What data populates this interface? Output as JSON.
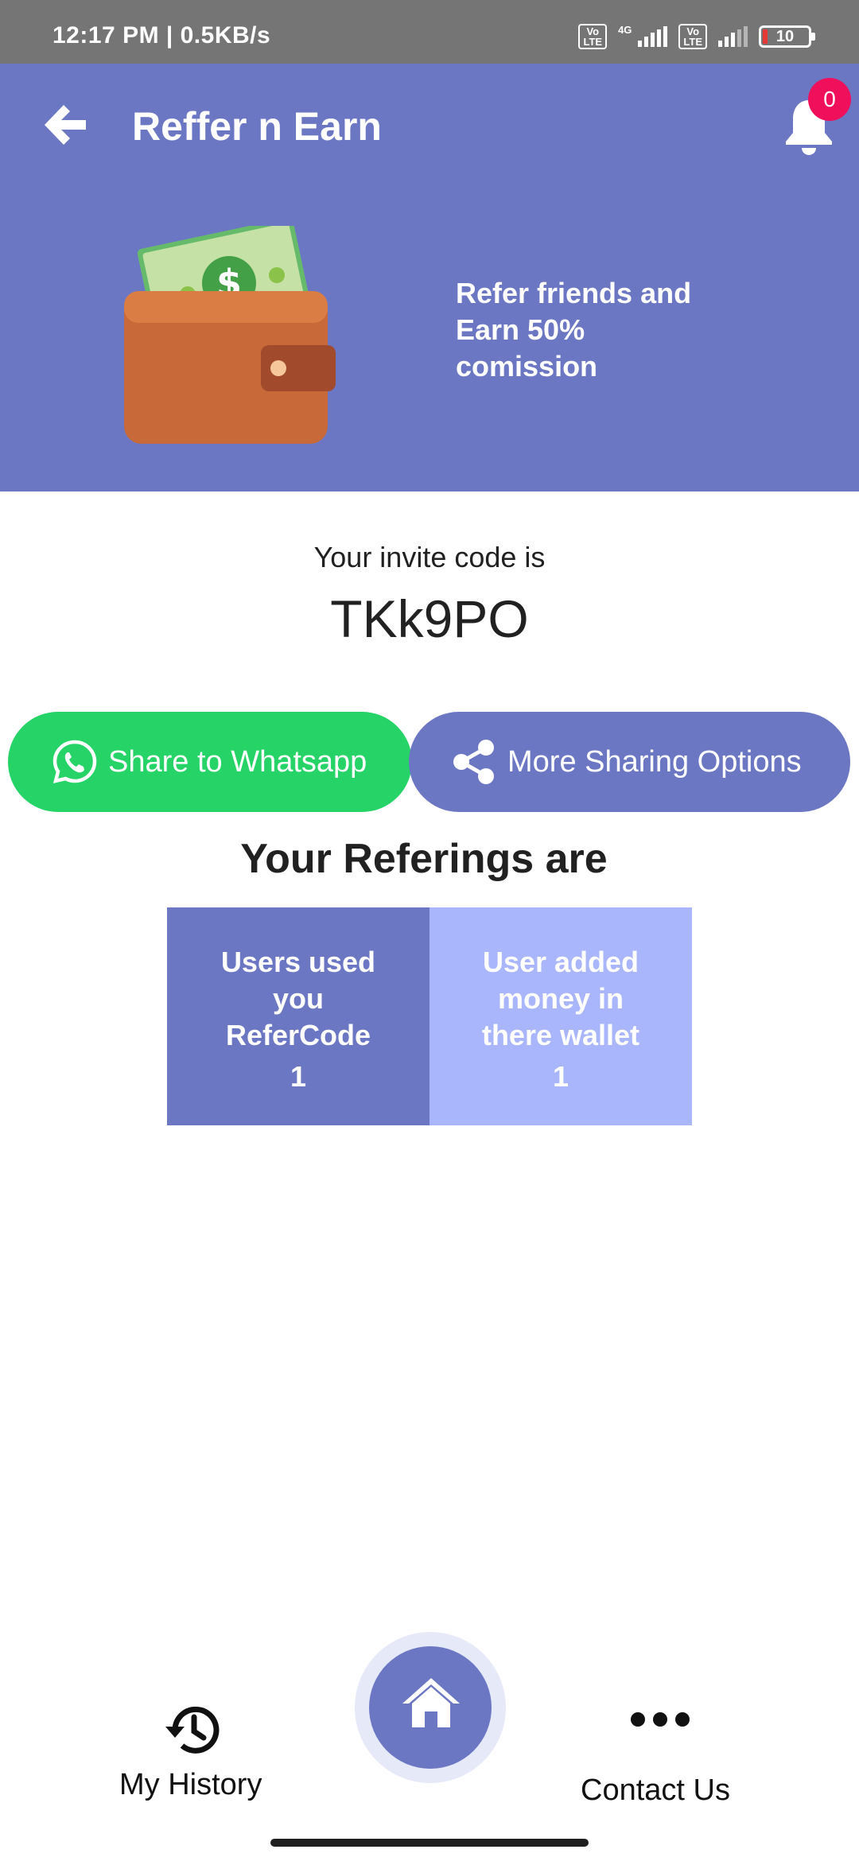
{
  "status_bar": {
    "time": "12:17 PM | 0.5KB/s",
    "volte_1": "Vo LTE",
    "net_type": "4G",
    "volte_2": "Vo LTE",
    "battery": "10"
  },
  "app_bar": {
    "title": "Reffer n Earn",
    "notification_count": "0"
  },
  "hero": {
    "text": "Refer friends and Earn 50% comission"
  },
  "invite": {
    "label": "Your invite code is",
    "code": "TKk9PO"
  },
  "share": {
    "whatsapp_label": "Share to Whatsapp",
    "more_label": "More Sharing Options"
  },
  "referings": {
    "title": "Your Referings are",
    "used_label": "Users used you ReferCode",
    "used_count": "1",
    "added_label": "User added money in there wallet",
    "added_count": "1"
  },
  "bottom_nav": {
    "history_label": "My History",
    "contact_label": "Contact Us"
  },
  "colors": {
    "primary": "#6c77c4",
    "light_primary": "#aab6fc",
    "whatsapp": "#25d366",
    "badge": "#ef0f5b",
    "status_bar": "#757575"
  },
  "icons": [
    "arrow-left-icon",
    "bell-icon",
    "wallet-illustration",
    "whatsapp-icon",
    "share-icon",
    "history-icon",
    "home-icon",
    "more-dots-icon"
  ]
}
